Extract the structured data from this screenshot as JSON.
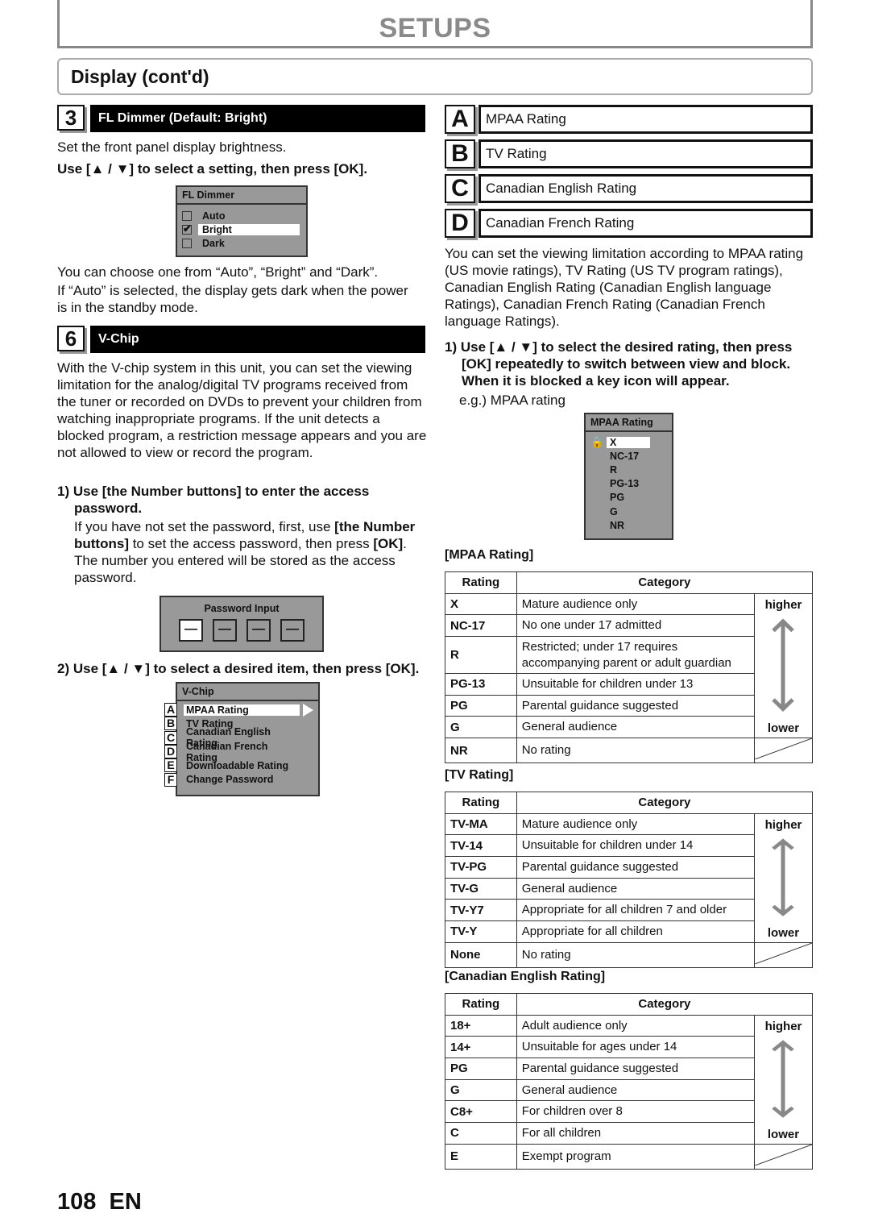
{
  "header": {
    "section": "SETUPS",
    "subsection": "Display (cont'd)"
  },
  "fl_dimmer": {
    "number": "3",
    "title": "FL Dimmer (Default: Bright)",
    "intro": "Set the front panel display brightness.",
    "instruction": "Use [▲ / ▼] to select a setting, then press [OK].",
    "osd": {
      "title": "FL Dimmer",
      "options": [
        {
          "label": "Auto",
          "checked": false
        },
        {
          "label": "Bright",
          "checked": true
        },
        {
          "label": "Dark",
          "checked": false
        }
      ]
    },
    "note1": "You can choose one from “Auto”, “Bright” and “Dark”.",
    "note2": "If “Auto” is selected, the display gets dark when the power is in the standby mode."
  },
  "vchip": {
    "number": "6",
    "title": "V-Chip",
    "intro": "With the V-chip system in this unit, you can set the viewing limitation for the analog/digital TV programs received from the tuner or recorded on DVDs to prevent your children from watching inappropriate programs. If the unit detects a blocked program, a restriction message appears and you are not allowed to view or record the program.",
    "step1_head": "1) Use [the Number buttons] to enter the access password.",
    "step1_body_a": "If you have not set the password, first, use ",
    "step1_body_b": "[the Number buttons]",
    "step1_body_c": " to set the access password, then press ",
    "step1_body_d": "[OK]",
    "step1_body_e": ". The number you entered will be stored as the access password.",
    "password_osd": {
      "title": "Password Input",
      "placeholder": "—"
    },
    "step2_head": "2) Use [▲ / ▼] to select a desired item, then press [OK].",
    "menu_osd": {
      "title": "V-Chip",
      "items": [
        {
          "letter": "A",
          "label": "MPAA Rating"
        },
        {
          "letter": "B",
          "label": "TV Rating"
        },
        {
          "letter": "C",
          "label": "Canadian English Rating"
        },
        {
          "letter": "D",
          "label": "Canadian French Rating"
        },
        {
          "letter": "E",
          "label": "Downloadable Rating"
        },
        {
          "letter": "F",
          "label": "Change Password"
        }
      ]
    }
  },
  "right": {
    "letters": [
      {
        "letter": "A",
        "label": "MPAA Rating"
      },
      {
        "letter": "B",
        "label": "TV Rating"
      },
      {
        "letter": "C",
        "label": "Canadian English Rating"
      },
      {
        "letter": "D",
        "label": "Canadian French Rating"
      }
    ],
    "intro": "You can set the viewing limitation according to MPAA rating (US movie ratings), TV Rating (US TV program ratings), Canadian English Rating (Canadian English language Ratings), Canadian French Rating (Canadian French language Ratings).",
    "step1": "1) Use [▲ / ▼] to select the desired rating, then press [OK] repeatedly to switch between view and block. When it is blocked a key icon will appear.",
    "example": "e.g.) MPAA rating",
    "mpaa_osd": {
      "title": "MPAA Rating",
      "items": [
        "X",
        "NC-17",
        "R",
        "PG-13",
        "PG",
        "G",
        "NR"
      ]
    },
    "col_rating": "Rating",
    "col_category": "Category",
    "higher": "higher",
    "lower": "lower",
    "tables": [
      {
        "title": "[MPAA Rating]",
        "rows": [
          [
            "X",
            "Mature audience only"
          ],
          [
            "NC-17",
            "No one under 17 admitted"
          ],
          [
            "R",
            "Restricted; under 17 requires accompanying parent or adult guardian"
          ],
          [
            "PG-13",
            "Unsuitable for children under 13"
          ],
          [
            "PG",
            "Parental guidance suggested"
          ],
          [
            "G",
            "General audience"
          ],
          [
            "NR",
            "No rating"
          ]
        ]
      },
      {
        "title": "[TV Rating]",
        "rows": [
          [
            "TV-MA",
            "Mature audience only"
          ],
          [
            "TV-14",
            "Unsuitable for children under 14"
          ],
          [
            "TV-PG",
            "Parental guidance suggested"
          ],
          [
            "TV-G",
            "General audience"
          ],
          [
            "TV-Y7",
            "Appropriate for all children 7 and older"
          ],
          [
            "TV-Y",
            "Appropriate for all children"
          ],
          [
            "None",
            "No rating"
          ]
        ]
      },
      {
        "title": "[Canadian English Rating]",
        "rows": [
          [
            "18+",
            "Adult audience only"
          ],
          [
            "14+",
            "Unsuitable for ages under 14"
          ],
          [
            "PG",
            "Parental guidance suggested"
          ],
          [
            "G",
            "General audience"
          ],
          [
            "C8+",
            "For children over 8"
          ],
          [
            "C",
            "For all children"
          ],
          [
            "E",
            "Exempt program"
          ]
        ]
      }
    ]
  },
  "footer": {
    "page": "108",
    "lang": "EN"
  }
}
